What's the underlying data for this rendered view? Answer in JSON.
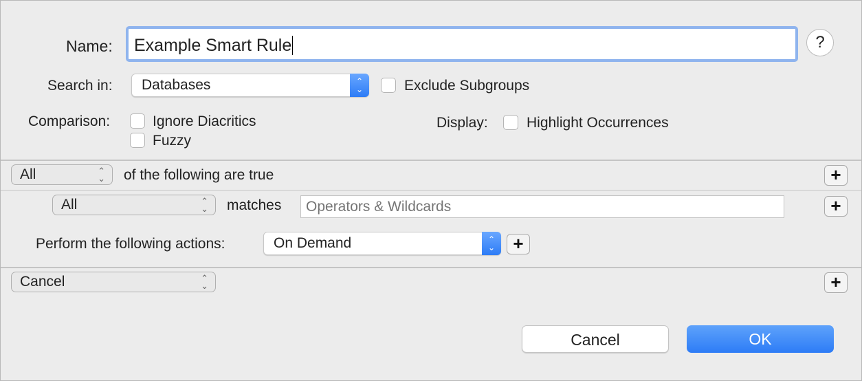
{
  "name": {
    "label": "Name:",
    "value": "Example Smart Rule"
  },
  "help": "?",
  "search_in": {
    "label": "Search in:",
    "value": "Databases",
    "exclude_subgroups": {
      "label": "Exclude Subgroups",
      "checked": false
    }
  },
  "comparison": {
    "label": "Comparison:",
    "ignore_diacritics": {
      "label": "Ignore Diacritics",
      "checked": false
    },
    "fuzzy": {
      "label": "Fuzzy",
      "checked": false
    }
  },
  "display": {
    "label": "Display:",
    "highlight": {
      "label": "Highlight Occurrences",
      "checked": false
    }
  },
  "conditions": {
    "quantifier": "All",
    "text": "of the following are true",
    "criterion": "All",
    "operator": "matches",
    "placeholder": "Operators & Wildcards"
  },
  "actions": {
    "label": "Perform the following actions:",
    "trigger": "On Demand",
    "action": "Cancel"
  },
  "buttons": {
    "cancel": "Cancel",
    "ok": "OK"
  },
  "colors": {
    "accent": "#2d7cf6",
    "focus_ring": "#8fb4ee"
  }
}
